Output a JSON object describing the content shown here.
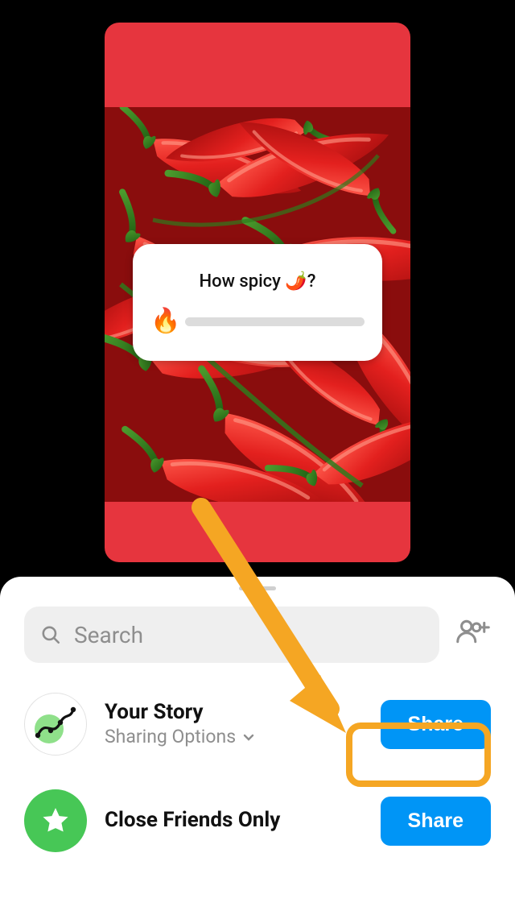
{
  "story": {
    "poll_question": "How spicy 🌶️?",
    "slider_emoji": "🔥"
  },
  "sheet": {
    "search_placeholder": "Search",
    "destinations": [
      {
        "id": "your-story",
        "title": "Your Story",
        "subtitle": "Sharing Options",
        "has_chevron": true,
        "button_label": "Share",
        "highlighted": true
      },
      {
        "id": "close-friends",
        "title": "Close Friends Only",
        "subtitle": "",
        "has_chevron": false,
        "button_label": "Share",
        "highlighted": false
      }
    ]
  },
  "colors": {
    "accent_blue": "#0095f6",
    "highlight_orange": "#f5a623",
    "story_bg": "#e6353e",
    "cf_green": "#47c756"
  }
}
